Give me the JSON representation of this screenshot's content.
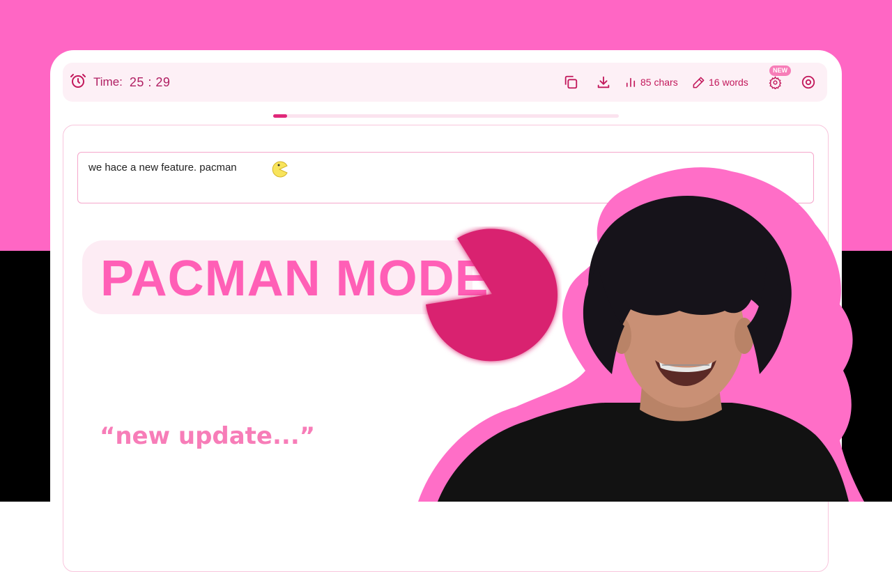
{
  "colors": {
    "background_top": "#ff66c4",
    "background_bottom": "#000000",
    "accent": "#c2185b",
    "title_pink": "#ff5fb6",
    "pacman_magenta": "#d9246f",
    "pacman_cursor_yellow": "#f8e45c"
  },
  "toolbar": {
    "timer_icon": "alarm-clock-icon",
    "timer_label": "Time:",
    "timer_value": "25 : 29",
    "copy_icon": "copy-icon",
    "download_icon": "download-icon",
    "chars_icon": "bar-chart-icon",
    "chars_label": "85 chars",
    "words_icon": "pencil-icon",
    "words_label": "16 words",
    "settings_icon": "gear-icon",
    "new_badge": "NEW",
    "focus_icon": "target-icon"
  },
  "progress": {
    "value_percent": 4
  },
  "editor": {
    "input_text": "we hace a new feature. pacman",
    "cursor_icon": "pacman-icon"
  },
  "overlay": {
    "title": "PACMAN MODE",
    "caption": "“new update...”",
    "pacman_graphic": "pacman-icon",
    "person_photo": "person-photo"
  }
}
